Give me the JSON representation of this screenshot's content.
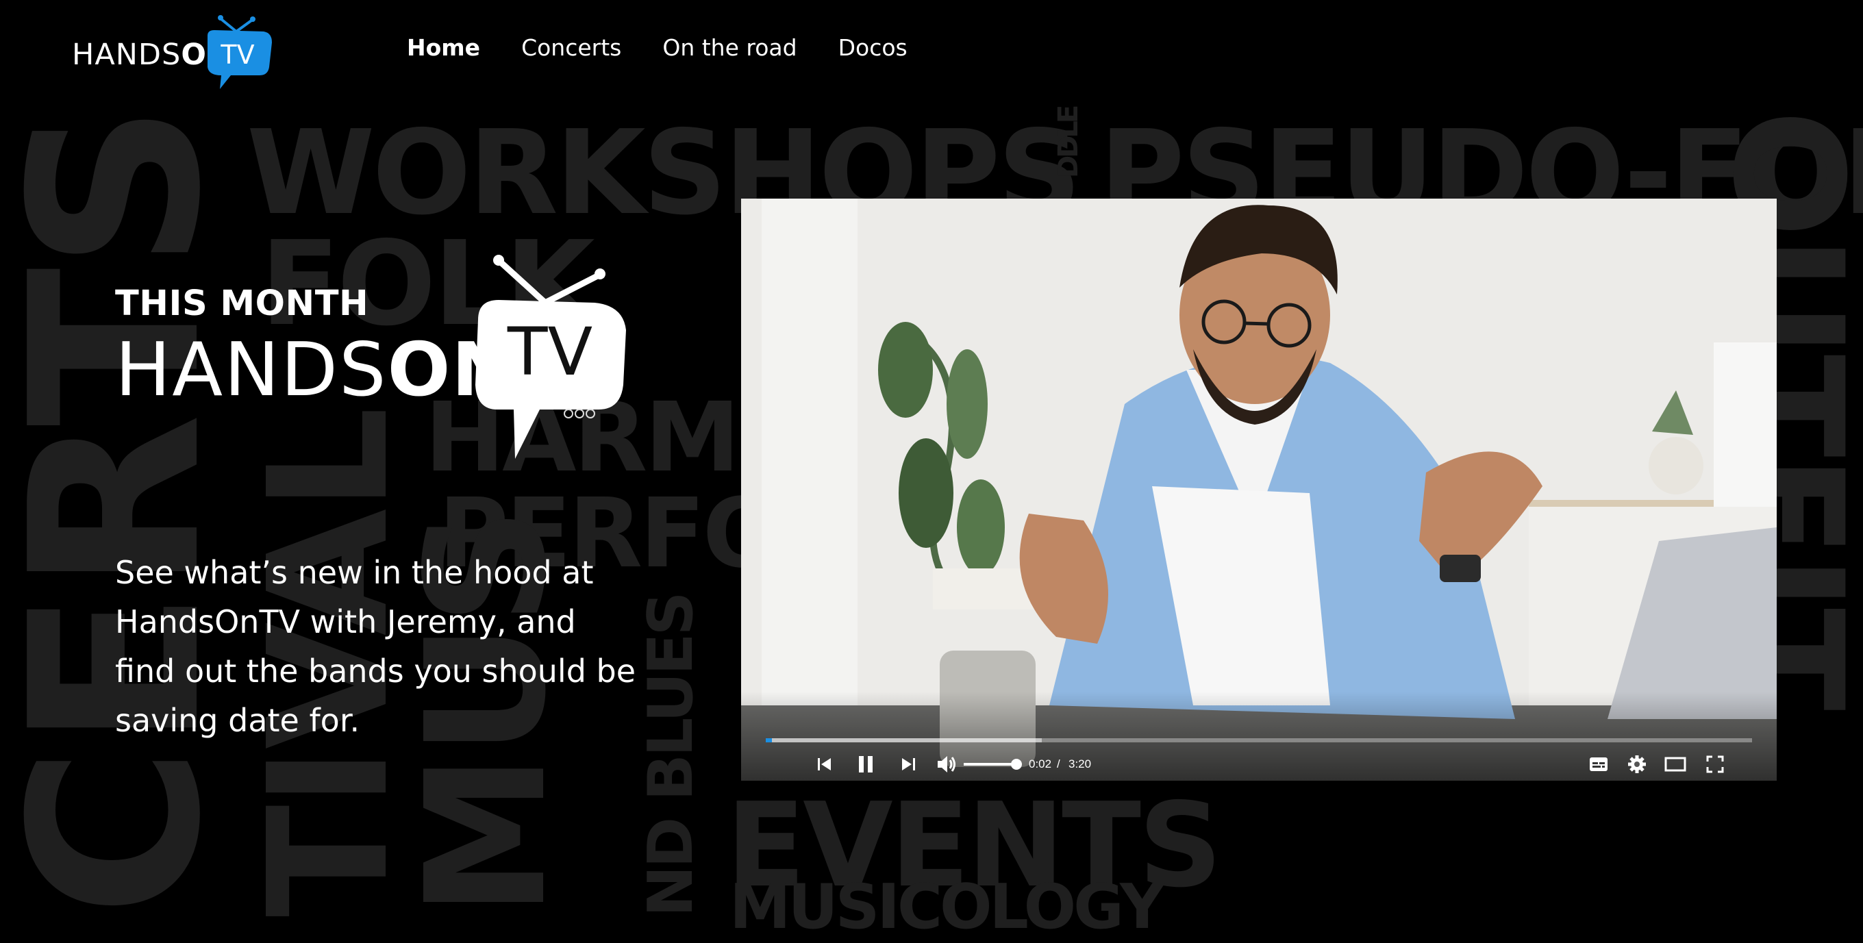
{
  "site": {
    "logo_text_regular": "HANDS",
    "logo_text_bold": "ON",
    "logo_tv": "TV"
  },
  "nav": {
    "items": [
      {
        "label": "Home",
        "active": true
      },
      {
        "label": "Concerts",
        "active": false
      },
      {
        "label": "On the road",
        "active": false
      },
      {
        "label": "Docos",
        "active": false
      }
    ]
  },
  "hero": {
    "kicker": "THIS MONTH",
    "logo_text_regular": "HANDS",
    "logo_text_bold": "ON",
    "logo_tv": "TV",
    "description": "See what’s new in the hood at HandsOnTV with Jeremy, and find out the  bands you should be saving date for."
  },
  "background_words": {
    "workshops": "WORKSHOPS",
    "pseudo_folk": "PSEUDO-FOL",
    "fiddle": "DDLE",
    "folk": "FOLK",
    "harm": "HARM",
    "perfo": "PERFO",
    "concerts": "CERTS",
    "festival": "TIVAL",
    "music": "MUS",
    "blues": "ND BLUES",
    "events": "EVENTS",
    "musicology": "MUSICOLOGY",
    "right_vertical": "OUTFIT"
  },
  "player": {
    "current_time": "0:02",
    "separator": "/",
    "duration": "3:20",
    "progress": 0.006,
    "buffered": 0.28,
    "volume": 0.9,
    "accent_color": "#1a8fe3"
  }
}
